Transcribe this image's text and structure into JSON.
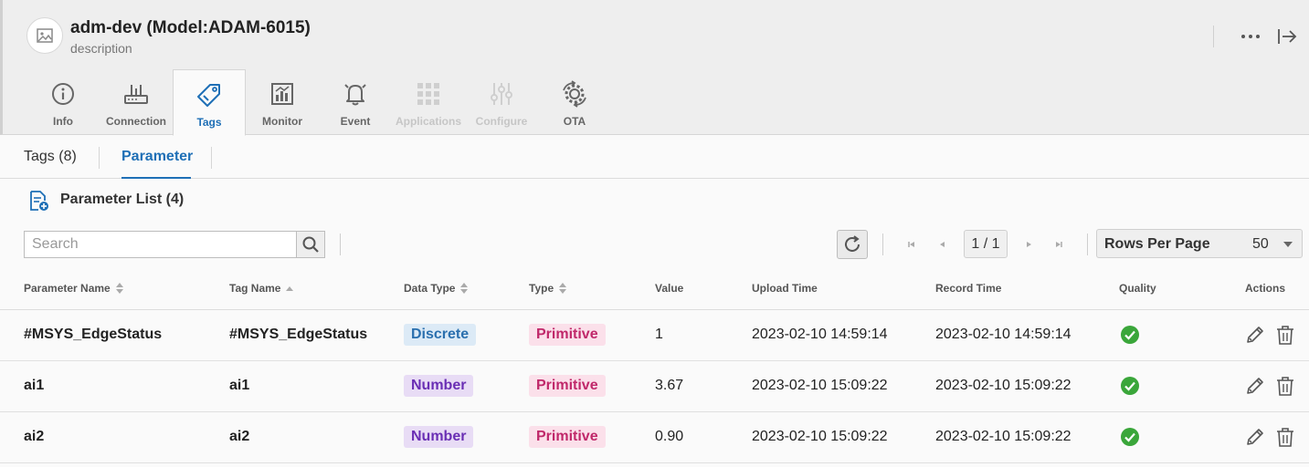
{
  "device": {
    "title": "adm-dev (Model:ADAM-6015)",
    "description": "description",
    "icons": {
      "avatar": "image-placeholder-icon",
      "more": "more-dots-icon",
      "exit": "exit-arrow-icon"
    }
  },
  "tabs": [
    {
      "label": "Info",
      "icon": "info-icon",
      "state": "normal"
    },
    {
      "label": "Connection",
      "icon": "router-icon",
      "state": "normal"
    },
    {
      "label": "Tags",
      "icon": "tag-icon",
      "state": "active"
    },
    {
      "label": "Monitor",
      "icon": "monitor-chart-icon",
      "state": "normal"
    },
    {
      "label": "Event",
      "icon": "bell-icon",
      "state": "normal"
    },
    {
      "label": "Applications",
      "icon": "grid-apps-icon",
      "state": "disabled"
    },
    {
      "label": "Configure",
      "icon": "sliders-icon",
      "state": "disabled"
    },
    {
      "label": "OTA",
      "icon": "ota-gear-icon",
      "state": "normal"
    }
  ],
  "subtabs": [
    {
      "label": "Tags (8)",
      "active": false
    },
    {
      "label": "Parameter",
      "active": true
    }
  ],
  "list": {
    "title": "Parameter List (4)",
    "icon": "document-add-icon"
  },
  "toolbar": {
    "search_placeholder": "Search",
    "page": "1 / 1",
    "rows_per_page_label": "Rows Per Page",
    "rows_per_page_value": "50"
  },
  "table": {
    "columns": [
      "Parameter Name",
      "Tag Name",
      "Data Type",
      "Type",
      "Value",
      "Upload Time",
      "Record Time",
      "Quality",
      "Actions"
    ],
    "rows": [
      {
        "parameter_name": "#MSYS_EdgeStatus",
        "tag_name": "#MSYS_EdgeStatus",
        "data_type": "Discrete",
        "type": "Primitive",
        "value": "1",
        "upload_time": "2023-02-10 14:59:14",
        "record_time": "2023-02-10 14:59:14",
        "quality": "good"
      },
      {
        "parameter_name": "ai1",
        "tag_name": "ai1",
        "data_type": "Number",
        "type": "Primitive",
        "value": "3.67",
        "upload_time": "2023-02-10 15:09:22",
        "record_time": "2023-02-10 15:09:22",
        "quality": "good"
      },
      {
        "parameter_name": "ai2",
        "tag_name": "ai2",
        "data_type": "Number",
        "type": "Primitive",
        "value": "0.90",
        "upload_time": "2023-02-10 15:09:22",
        "record_time": "2023-02-10 15:09:22",
        "quality": "good"
      }
    ]
  },
  "colors": {
    "accent": "#1e6fb6",
    "good": "#3aa63a",
    "primitive": "#c0286a",
    "number": "#6a2fb4",
    "discrete": "#2a6fae"
  }
}
